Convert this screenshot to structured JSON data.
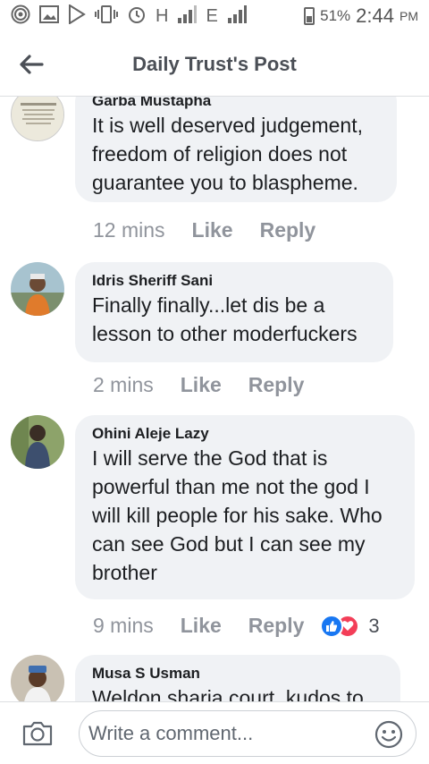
{
  "status_bar": {
    "battery": "51%",
    "time": "2:44",
    "ampm": "PM",
    "network_1": "H",
    "network_2": "E"
  },
  "header": {
    "title": "Daily Trust's Post"
  },
  "comments": [
    {
      "author": "Garba Mustapha",
      "lines": [
        "It is well deserved judgement,",
        "freedom of religion does not",
        "guarantee you to blaspheme."
      ],
      "time": "12 mins",
      "like": "Like",
      "reply": "Reply"
    },
    {
      "author": "Idris Sheriff Sani",
      "lines": [
        "Finally finally...let dis be a",
        "lesson to other moderfuckers"
      ],
      "time": "2 mins",
      "like": "Like",
      "reply": "Reply"
    },
    {
      "author": "Ohini Aleje Lazy",
      "lines": [
        "I will serve the God that is",
        "powerful than me not the god I",
        "will kill people for his sake. Who",
        "can see God but I can see my",
        "brother"
      ],
      "time": "9 mins",
      "like": "Like",
      "reply": "Reply",
      "reaction_count": "3",
      "reaction_icons": [
        "like-reaction",
        "love-reaction"
      ]
    },
    {
      "author": "Musa S Usman",
      "lines": [
        "Weldon sharia court, kudos to"
      ]
    }
  ],
  "composer": {
    "placeholder": "Write a comment..."
  },
  "colors": {
    "bubble": "#f0f2f5",
    "meta_text": "#90949c",
    "like_blue": "#1877f2",
    "love_red": "#f33e58"
  }
}
